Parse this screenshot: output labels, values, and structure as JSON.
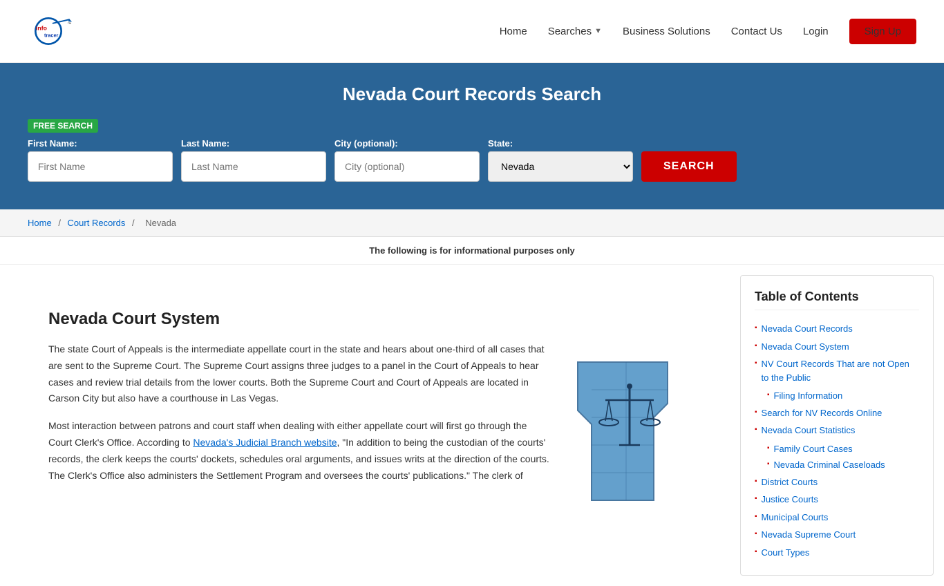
{
  "header": {
    "logo_info": "info",
    "logo_tracer": "tracer",
    "logo_tm": "™",
    "nav": {
      "home": "Home",
      "searches": "Searches",
      "business_solutions": "Business Solutions",
      "contact_us": "Contact Us",
      "login": "Login",
      "sign_up": "Sign Up"
    }
  },
  "hero": {
    "title": "Nevada Court Records Search",
    "free_badge": "FREE SEARCH",
    "first_name_label": "First Name:",
    "first_name_placeholder": "First Name",
    "last_name_label": "Last Name:",
    "last_name_placeholder": "Last Name",
    "city_label": "City (optional):",
    "city_placeholder": "City (optional)",
    "state_label": "State:",
    "state_value": "Nevada",
    "search_button": "SEARCH"
  },
  "breadcrumb": {
    "home": "Home",
    "court_records": "Court Records",
    "nevada": "Nevada"
  },
  "info_banner": "The following is for informational purposes only",
  "article": {
    "title": "Nevada Court System",
    "para1": "The state Court of Appeals is the intermediate appellate court in the state and hears about one-third of all cases that are sent to the Supreme Court. The Supreme Court assigns three judges to a panel in the Court of Appeals to hear cases and review trial details from the lower courts. Both the Supreme Court and Court of Appeals are located in Carson City but also have a courthouse in Las Vegas.",
    "para2": "Most interaction between patrons and court staff when dealing with either appellate court will first go through the Court Clerk's Office. According to ",
    "nevada_link": "Nevada's Judicial Branch website",
    "para2b": ", \"In addition to being the custodian of the courts' records, the clerk keeps the courts' dockets, schedules oral arguments, and issues writs at the direction of the courts. The Clerk's Office also administers the Settlement Program and oversees the courts' publications.\" The clerk of"
  },
  "toc": {
    "title": "Table of Contents",
    "items": [
      {
        "label": "Nevada Court Records",
        "id": "nevada-court-records",
        "subitems": []
      },
      {
        "label": "Nevada Court System",
        "id": "nevada-court-system",
        "subitems": []
      },
      {
        "label": "NV Court Records That are not Open to the Public",
        "id": "nv-not-public",
        "subitems": [
          {
            "label": "Filing Information",
            "id": "filing-information"
          }
        ]
      },
      {
        "label": "Search for NV Records Online",
        "id": "search-nv-online",
        "subitems": []
      },
      {
        "label": "Nevada Court Statistics",
        "id": "nevada-court-statistics",
        "subitems": [
          {
            "label": "Family Court Cases",
            "id": "family-court-cases"
          },
          {
            "label": "Nevada Criminal Caseloads",
            "id": "nevada-criminal-caseloads"
          }
        ]
      },
      {
        "label": "District Courts",
        "id": "district-courts",
        "subitems": []
      },
      {
        "label": "Justice Courts",
        "id": "justice-courts",
        "subitems": []
      },
      {
        "label": "Municipal Courts",
        "id": "municipal-courts",
        "subitems": []
      },
      {
        "label": "Nevada Supreme Court",
        "id": "nevada-supreme-court",
        "subitems": []
      },
      {
        "label": "Court Types",
        "id": "court-types",
        "subitems": []
      }
    ]
  }
}
